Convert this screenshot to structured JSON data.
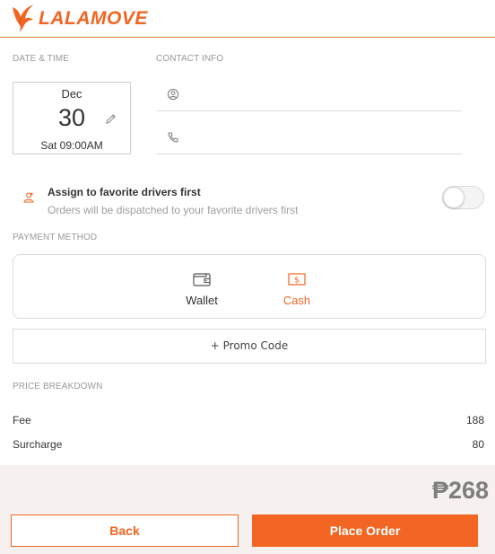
{
  "brand": {
    "name": "LALAMOVE",
    "accent": "#f26522"
  },
  "date_time": {
    "label": "DATE & TIME",
    "month": "Dec",
    "day": "30",
    "day_time": "Sat 09:00AM"
  },
  "contact": {
    "label": "CONTACT INFO",
    "name_icon": "user-icon",
    "phone_icon": "phone-icon",
    "name_value": "",
    "phone_value": ""
  },
  "favorite": {
    "title": "Assign to favorite drivers first",
    "subtitle": "Orders will be dispatched to your favorite drivers first",
    "enabled": false
  },
  "payment": {
    "label": "PAYMENT METHOD",
    "options": [
      {
        "label": "Wallet",
        "icon": "wallet-icon",
        "selected": false
      },
      {
        "label": "Cash",
        "icon": "cash-icon",
        "selected": true
      }
    ]
  },
  "promo": {
    "label": "+ Promo Code"
  },
  "price_breakdown": {
    "label": "PRICE BREAKDOWN",
    "items": [
      {
        "name": "Fee",
        "value": "188"
      },
      {
        "name": "Surcharge",
        "value": "80"
      }
    ]
  },
  "footer": {
    "total": "₱268",
    "back_label": "Back",
    "place_order_label": "Place Order"
  }
}
